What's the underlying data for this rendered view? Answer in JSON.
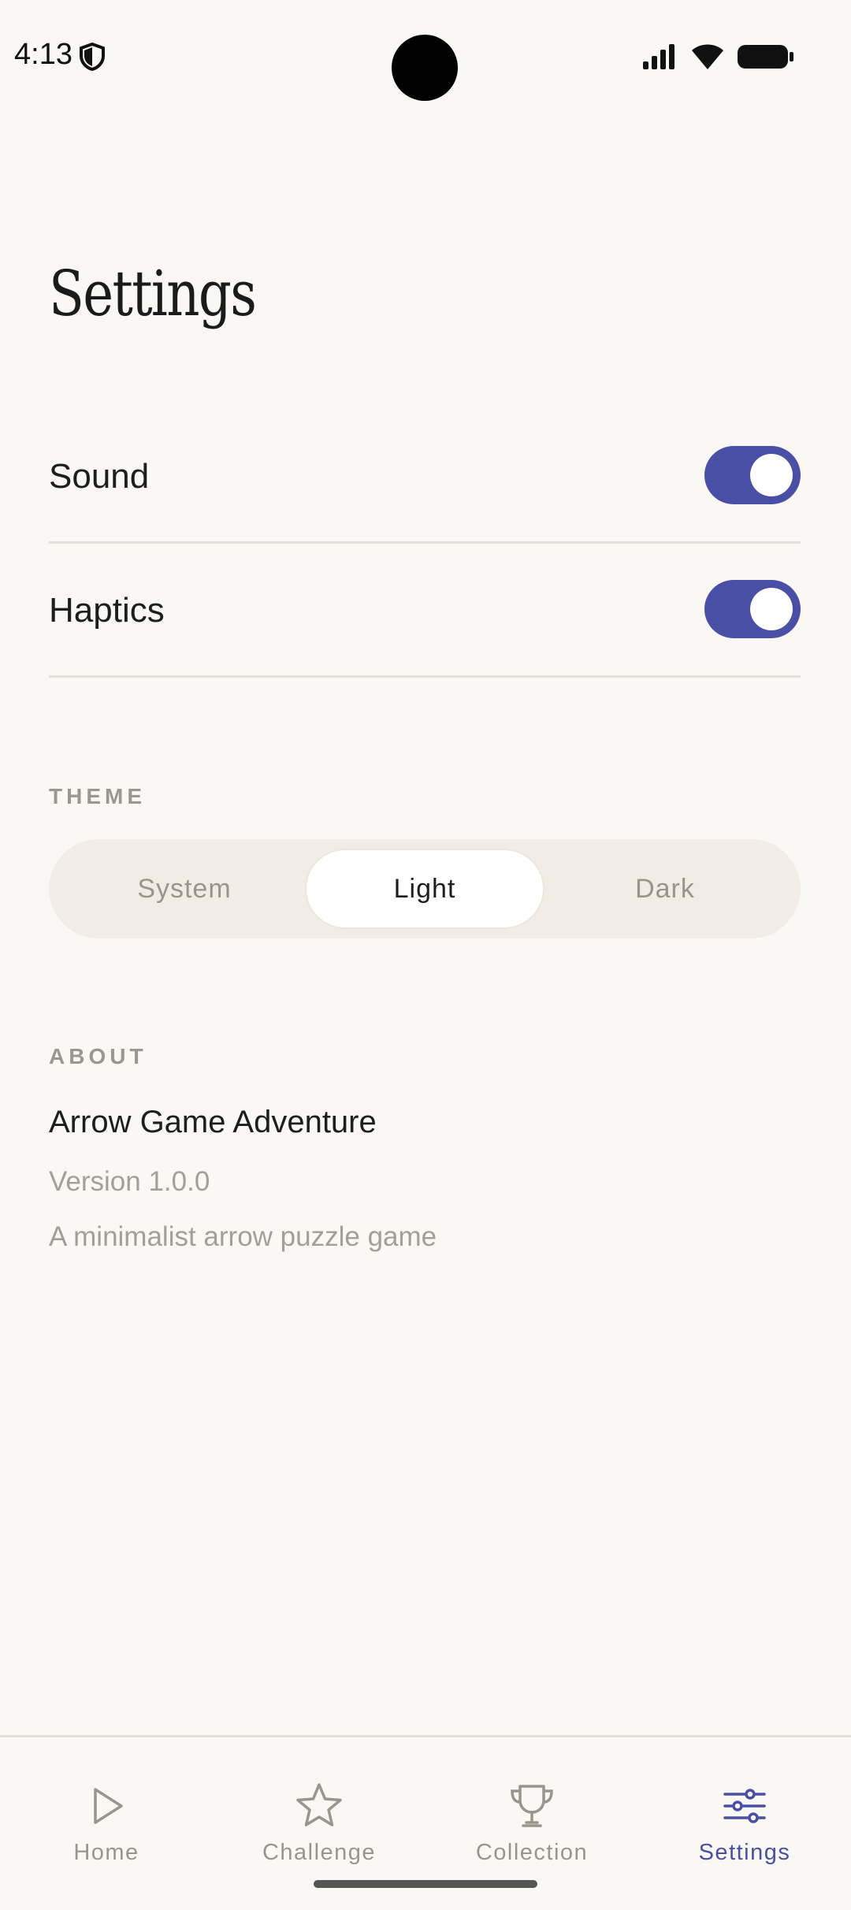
{
  "status_bar": {
    "time": "4:13"
  },
  "title": "Settings",
  "settings": {
    "sound": {
      "label": "Sound",
      "enabled": true
    },
    "haptics": {
      "label": "Haptics",
      "enabled": true
    }
  },
  "theme": {
    "header": "THEME",
    "options": [
      "System",
      "Light",
      "Dark"
    ],
    "selected": "Light"
  },
  "about": {
    "header": "ABOUT",
    "app_name": "Arrow Game Adventure",
    "version": "Version 1.0.0",
    "description": "A minimalist arrow puzzle game"
  },
  "nav": {
    "items": [
      {
        "label": "Home",
        "icon": "play-icon"
      },
      {
        "label": "Challenge",
        "icon": "star-icon"
      },
      {
        "label": "Collection",
        "icon": "trophy-icon"
      },
      {
        "label": "Settings",
        "icon": "sliders-icon"
      }
    ],
    "active": "Settings"
  },
  "colors": {
    "accent": "#4A4FA6",
    "background": "#F9F8F5",
    "muted_text": "#9A958C"
  }
}
